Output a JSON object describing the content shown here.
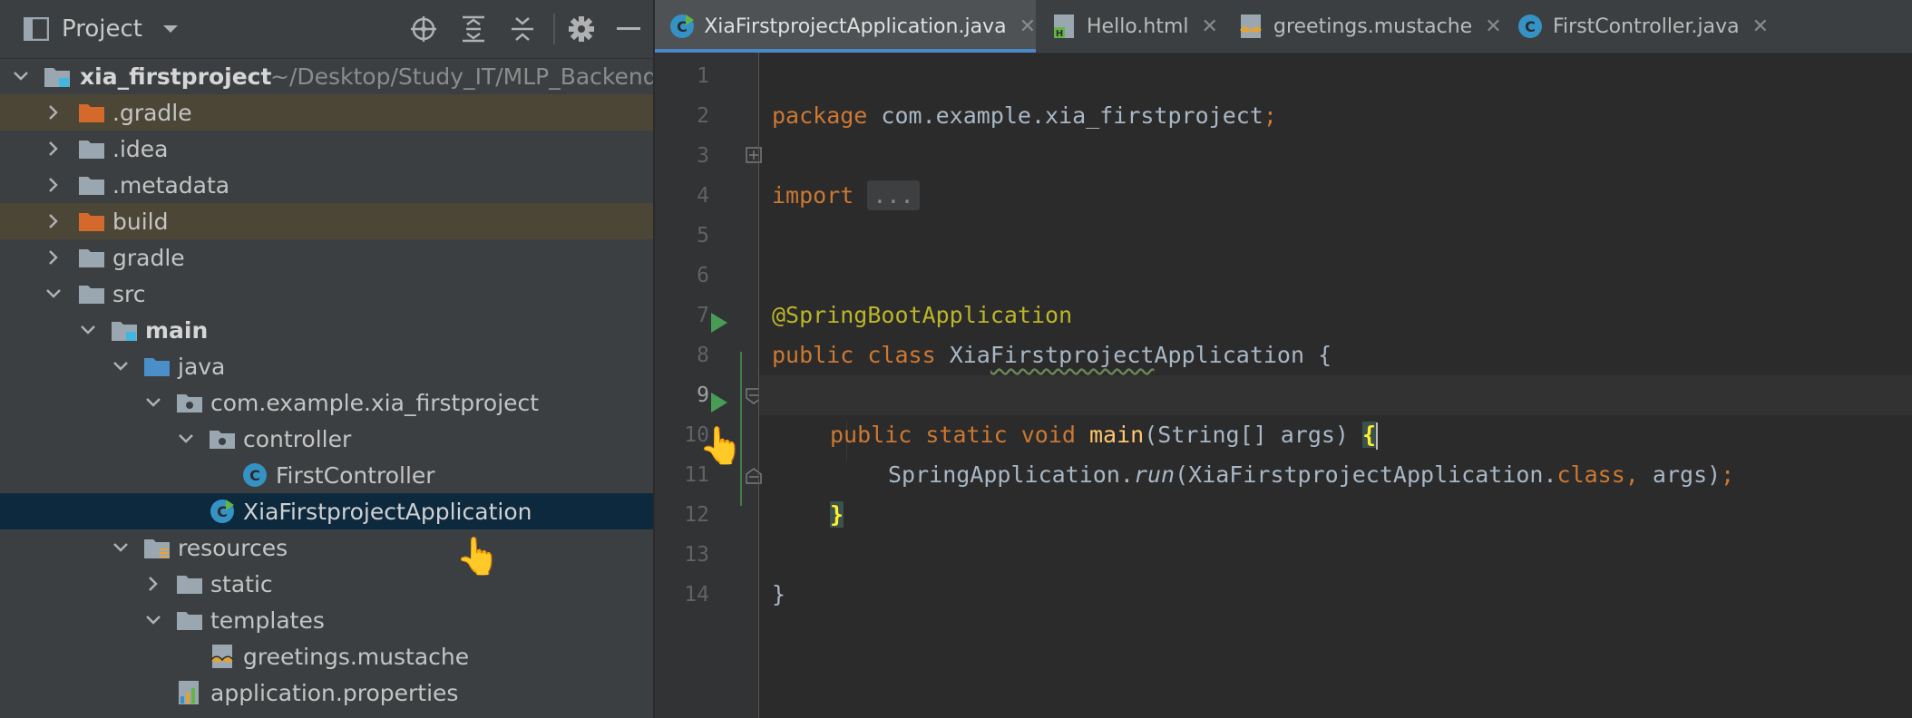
{
  "project_panel": {
    "title": "Project",
    "toolbar_icons": [
      "locate-icon",
      "expand-all-icon",
      "collapse-all-icon",
      "gear-icon",
      "hide-icon"
    ],
    "root": {
      "name": "xia_firstproject",
      "path": "~/Desktop/Study_IT/MLP_Backend/"
    },
    "items": [
      {
        "label": ".gradle",
        "state": "collapsed",
        "icon": "folder-excluded"
      },
      {
        "label": ".idea",
        "state": "collapsed",
        "icon": "folder"
      },
      {
        "label": ".metadata",
        "state": "collapsed",
        "icon": "folder"
      },
      {
        "label": "build",
        "state": "collapsed",
        "icon": "folder-excluded"
      },
      {
        "label": "gradle",
        "state": "collapsed",
        "icon": "folder"
      },
      {
        "label": "src",
        "state": "expanded",
        "icon": "folder"
      },
      {
        "label": "main",
        "state": "expanded",
        "icon": "module-folder"
      },
      {
        "label": "java",
        "state": "expanded",
        "icon": "source-folder"
      },
      {
        "label": "com.example.xia_firstproject",
        "state": "expanded",
        "icon": "package"
      },
      {
        "label": "controller",
        "state": "expanded",
        "icon": "package"
      },
      {
        "label": "FirstController",
        "state": "leaf",
        "icon": "java-class"
      },
      {
        "label": "XiaFirstprojectApplication",
        "state": "leaf",
        "icon": "spring-class"
      },
      {
        "label": "resources",
        "state": "expanded",
        "icon": "resources-folder"
      },
      {
        "label": "static",
        "state": "collapsed",
        "icon": "folder"
      },
      {
        "label": "templates",
        "state": "expanded",
        "icon": "folder"
      },
      {
        "label": "greetings.mustache",
        "state": "leaf",
        "icon": "mustache-file"
      },
      {
        "label": "application.properties",
        "state": "leaf",
        "icon": "properties-file"
      }
    ]
  },
  "tabs": [
    {
      "label": "XiaFirstprojectApplication.java",
      "icon": "spring-class",
      "active": true
    },
    {
      "label": "Hello.html",
      "icon": "html-file",
      "active": false
    },
    {
      "label": "greetings.mustache",
      "icon": "mustache-file",
      "active": false
    },
    {
      "label": "FirstController.java",
      "icon": "java-class",
      "active": false
    }
  ],
  "editor": {
    "line_numbers": [
      "1",
      "2",
      "3",
      "4",
      "5",
      "6",
      "7",
      "8",
      "9",
      "10",
      "11",
      "12",
      "13",
      "14"
    ],
    "current_line": "9",
    "code": {
      "l1_kw": "package",
      "l1_rest": " com.example.xia_firstproject",
      "l1_semi": ";",
      "l3_kw": "import",
      "l3_fold": "...",
      "l6_ann": "@SpringBootApplication",
      "l7_kw": "public class",
      "l7_name_a": "Xia",
      "l7_name_b": "Firstproject",
      "l7_name_c": "Application {",
      "l9_kw": "public static void",
      "l9_fn": "main",
      "l9_args": "(String[] args) ",
      "l9_brace": "{",
      "l10_cls": "SpringApplication.",
      "l10_run": "run",
      "l10_args": "(XiaFirstprojectApplication.",
      "l10_kw": "class",
      "l10_comma": ",",
      "l10_end": " args)",
      "l10_semi": ";",
      "l11_brace": "}",
      "l13_brace": "}"
    }
  }
}
